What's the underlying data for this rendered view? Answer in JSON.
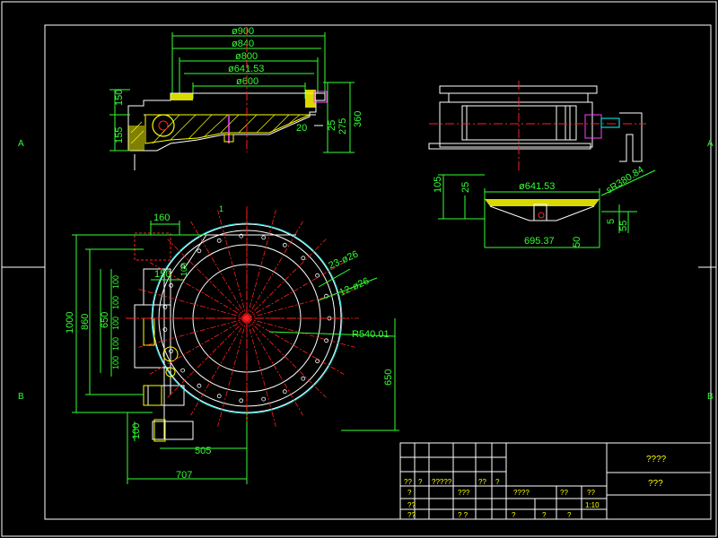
{
  "colors": {
    "background": "#000000",
    "frame": "#ffffff",
    "outline": "#ffffff",
    "dimension": "#33ff33",
    "centerline": "#ff2020",
    "hatch": "#ffff00",
    "cyan": "#00ffff",
    "magenta": "#ff40ff"
  },
  "zones": {
    "left_a": "A",
    "right_a": "A",
    "left_b": "B",
    "right_b": "B"
  },
  "front_view": {
    "d900": "ø900",
    "d840": "ø840",
    "d800": "ø800",
    "d641": "ø641.53",
    "d600": "ø600",
    "h150": "150",
    "h155": "155",
    "h20": "20",
    "h25": "25",
    "h275": "275",
    "h360": "360"
  },
  "side_detail": {
    "h105": "105",
    "h25": "25",
    "d641": "ø641.53",
    "sr": "sR380.84",
    "h5": "5",
    "h55": "55",
    "w695": "695.37",
    "h50": "50"
  },
  "plan_view": {
    "w160": "160",
    "w150": "150",
    "h1000": "1000",
    "h860": "860",
    "h650": "650",
    "p100": [
      "100",
      "100",
      "100",
      "100",
      "100",
      "100"
    ],
    "holes23": "23-ø26",
    "holes12": "12-ø26",
    "radius": "R540.01",
    "v650": "650",
    "h100": "100",
    "w505": "505",
    "w707": "707",
    "item1": "1"
  },
  "title_block": {
    "title1": "????",
    "title2": "???",
    "c1": "??",
    "c2": "?",
    "c3": "?????",
    "c4": "??",
    "c5": "?",
    "c6": "?",
    "c7": "???",
    "c8": "????",
    "c9": "??",
    "c10": "??",
    "c11": "1:10",
    "c12": "??",
    "c13": "??",
    "c14": "? ?",
    "c15": "?",
    "c16": "?",
    "c17": "?"
  }
}
